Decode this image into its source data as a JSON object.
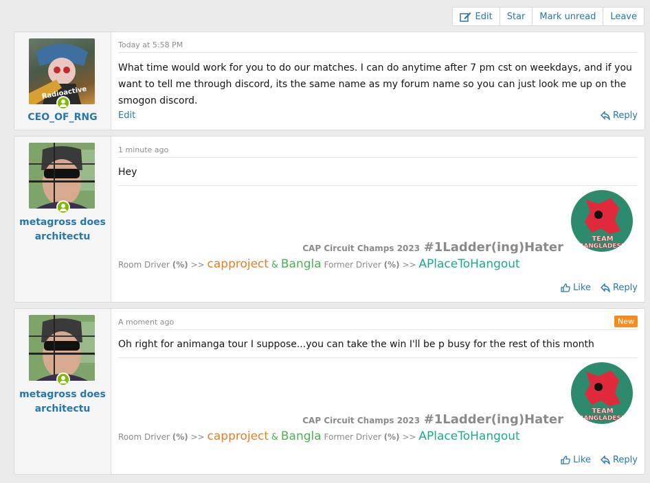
{
  "toolbar": {
    "edit_label": "Edit",
    "star_label": "Star",
    "mark_unread_label": "Mark unread",
    "leave_label": "Leave"
  },
  "posts": [
    {
      "username": "CEO_OF_RNG",
      "avatar_caption": "Radioactive",
      "time": "Today at 5:58 PM",
      "content": "What time would work for you to do our matches. I can do anytime after 7 pm cst on weekdays, and if you want to tell me through discord, its the same name as my forum name so you can just look me up on the smogon discord.",
      "edit_label": "Edit",
      "reply_label": "Reply"
    },
    {
      "username_line1": "metagross does",
      "username_line2": "architectu",
      "time": "1 minute ago",
      "content": "Hey",
      "like_label": "Like",
      "reply_label": "Reply"
    },
    {
      "username_line1": "metagross does",
      "username_line2": "architectu",
      "time": "A moment ago",
      "badge": "New",
      "content": "Oh right for animanga tour I suppose...you can take the win I'll be p busy for the rest of this month",
      "like_label": "Like",
      "reply_label": "Reply"
    }
  ],
  "signature": {
    "champs": "CAP Circuit Champs 2023",
    "hater": "#1Ladder(ing)Hater",
    "room_driver": "Room Driver",
    "pct": "(%)",
    "arrows": ">>",
    "capproject": "capproject",
    "amp": "&",
    "bangla": "Bangla",
    "former_driver": "Former Driver",
    "hangout": "APlaceToHangout",
    "emblem_text_1": "TEAM",
    "emblem_text_2": "BANGLADESH"
  },
  "colors": {
    "link": "#2577b1",
    "new_badge": "#f78c1e",
    "online": "#7fb900",
    "emblem_bg": "#2d8a6c",
    "emblem_figure": "#e0293a"
  }
}
